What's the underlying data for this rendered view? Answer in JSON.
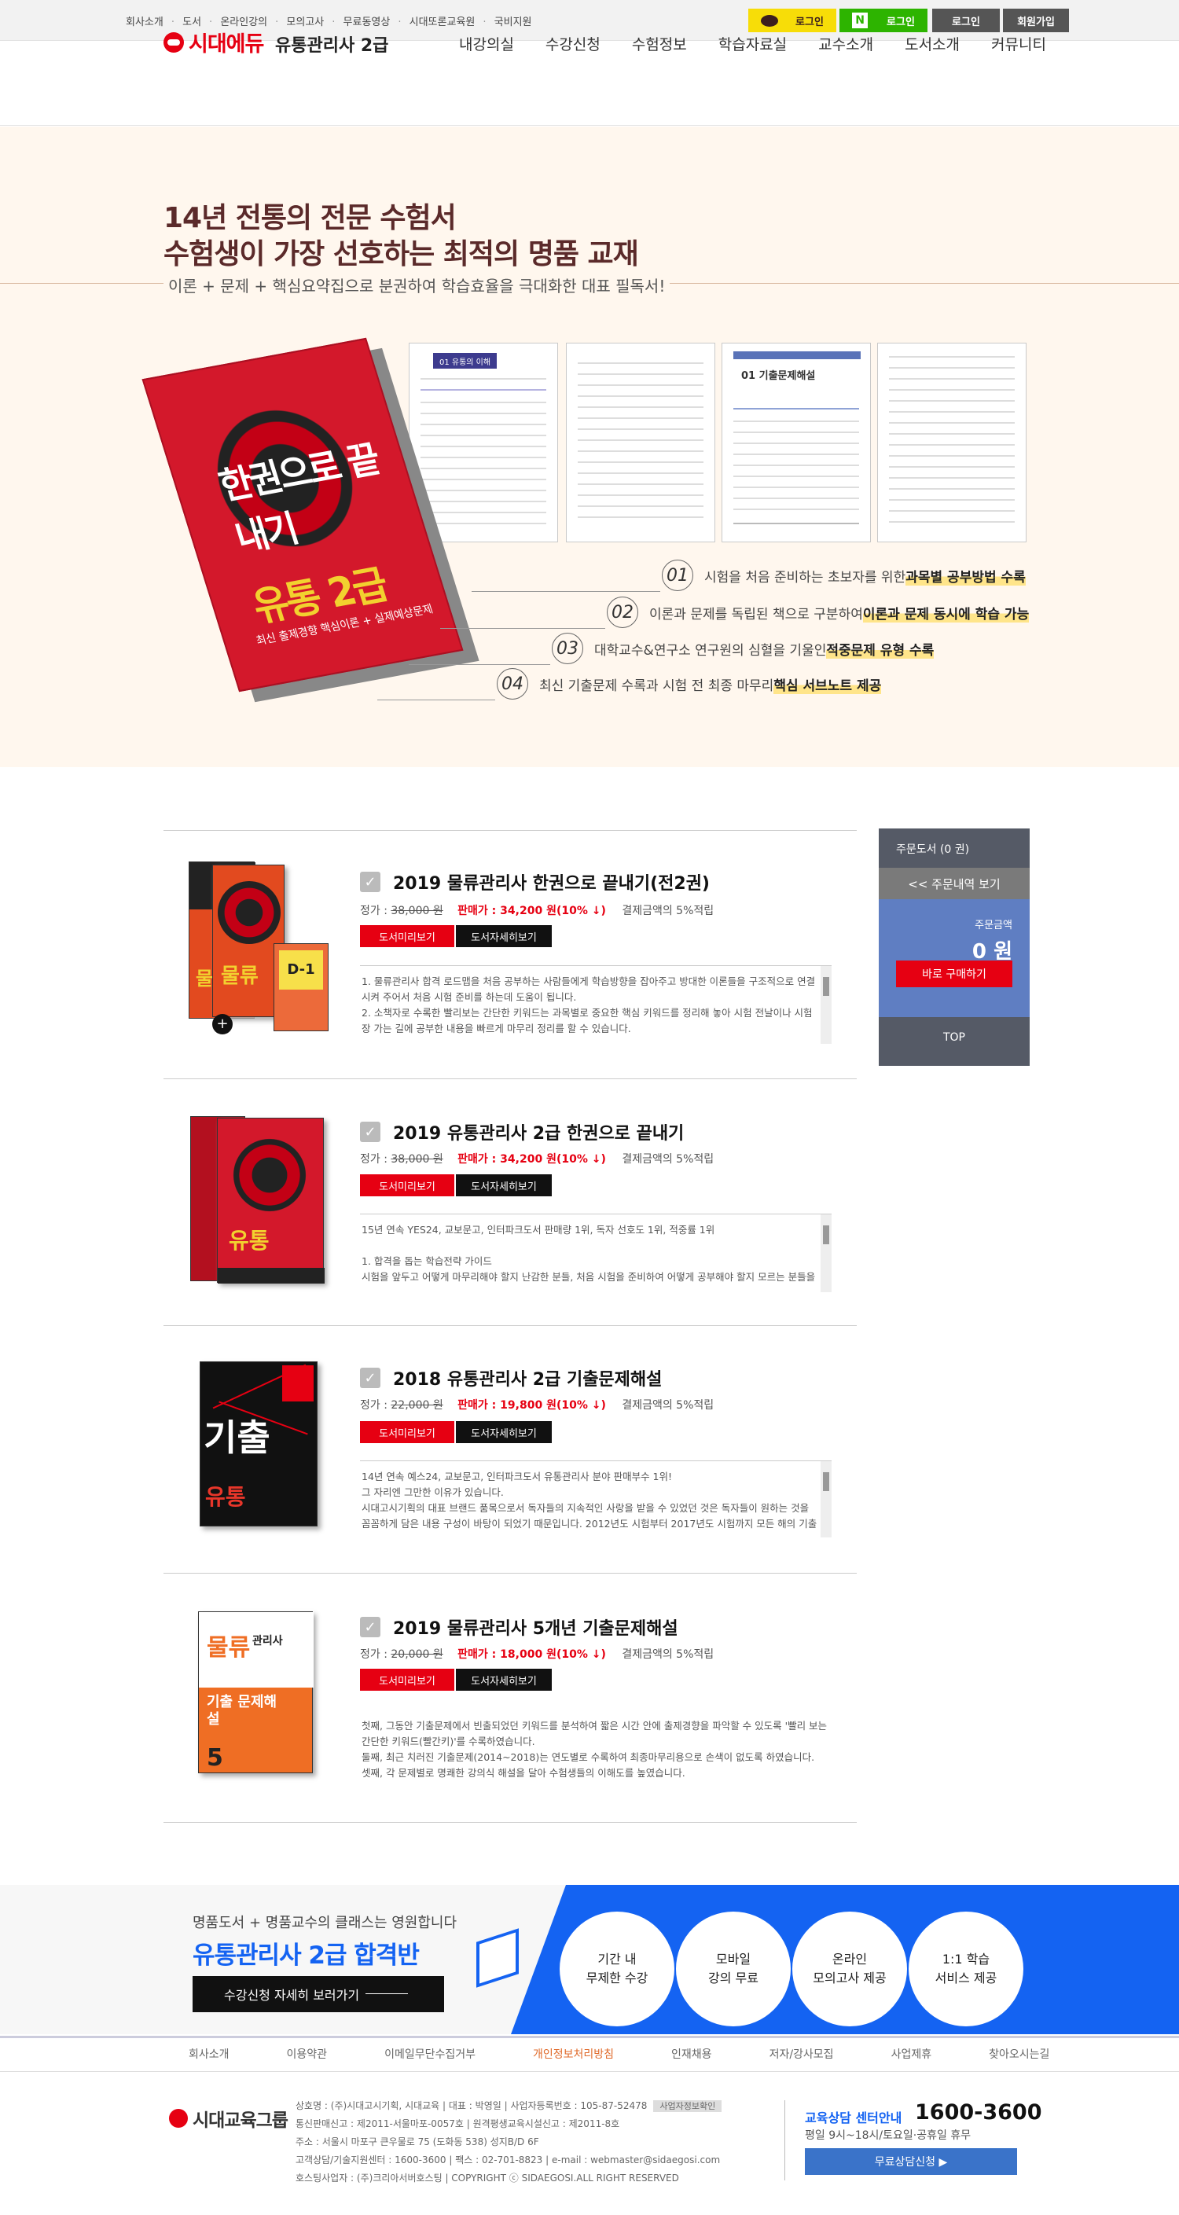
{
  "topbar": {
    "links": [
      "회사소개",
      "도서",
      "온라인강의",
      "모의고사",
      "무료동영상",
      "시대또론교육원",
      "국비지원"
    ],
    "kakao_login": "로그인",
    "naver_login": "로그인",
    "login": "로그인",
    "join": "회원가입"
  },
  "header": {
    "logo": "시대에듀",
    "site_name": "유통관리사 2급",
    "nav": [
      "내강의실",
      "수강신청",
      "수험정보",
      "학습자료실",
      "교수소개",
      "도서소개",
      "커뮤니티"
    ]
  },
  "hero": {
    "title_line1": "14년 전통의 전문 수험서",
    "title_line2": "수험생이 가장 선호하는 최적의 명품 교재",
    "subtitle": "이론 + 문제 + 핵심요약집으로 분권하여 학습효율을 극대화한 대표 필독서!",
    "book_title": "한권으로 끝내기",
    "book_subject": "유통 2급",
    "book_tagline": "최신 출제경향 핵심이론 + 실제예상문제",
    "page_headings": [
      "01 유통의 이해",
      "01 기출문제해설"
    ],
    "features": [
      {
        "num": "01",
        "text": "시험을 처음 준비하는 초보자를 위한 ",
        "highlight": "과목별 공부방법 수록"
      },
      {
        "num": "02",
        "text": "이론과 문제를 독립된 책으로 구분하여 ",
        "highlight": "이론과 문제 동시에 학습 가능"
      },
      {
        "num": "03",
        "text": "대학교수&연구소 연구원의 심혈을 기울인 ",
        "highlight": "적중문제 유형 수록"
      },
      {
        "num": "04",
        "text": "최신 기출문제 수록과 시험 전 최종 마무리 ",
        "highlight": "핵심 서브노트 제공"
      }
    ]
  },
  "products": [
    {
      "title": "2019 물류관리사 한권으로 끝내기(전2권)",
      "price_label": "정가 :",
      "orig_price": "38,000 원",
      "sale_label": "판매가 :",
      "sale_price": "34,200 원(10% ↓)",
      "point": "결제금액의 5%적립",
      "preview_btn": "도서미리보기",
      "detail_btn": "도서자세히보기",
      "desc": [
        "1. 물류관리사 합격 로드맵을 처음 공부하는 사람들에게 학습방향을 잡아주고 방대한 이론들을 구조적으로 연결시켜 주어서 처음 시험 준비를 하는데 도움이 됩니다.",
        "2. 소책자로 수록한 빨리보는 간단한 키워드는 과목별로 중요한 핵심 키워드를 정리해 놓아 시험 전날이나 시험장 가는 길에 공부한 내용을 빠르게 마무리 정리를 할 수 있습니다."
      ],
      "cover_main": "물류",
      "cover_side": "D-1"
    },
    {
      "title": "2019 유통관리사 2급 한권으로 끝내기",
      "price_label": "정가 :",
      "orig_price": "38,000 원",
      "sale_label": "판매가 :",
      "sale_price": "34,200 원(10% ↓)",
      "point": "결제금액의 5%적립",
      "preview_btn": "도서미리보기",
      "detail_btn": "도서자세히보기",
      "desc": [
        "15년 연속 YES24, 교보문고, 인터파크도서 판매량 1위, 독자 선호도 1위, 적중률 1위",
        "",
        "1. 합격을 돕는 학습전략 가이드",
        "시험을 앞두고 어떻게 마무리해야 할지 난감한 분들, 처음 시험을 준비하여 어떻게 공부해야 할지 모르는 분들을"
      ],
      "cover_main": "유통"
    },
    {
      "title": "2018 유통관리사 2급 기출문제해설",
      "price_label": "정가 :",
      "orig_price": "22,000 원",
      "sale_label": "판매가 :",
      "sale_price": "19,800 원(10% ↓)",
      "point": "결제금액의 5%적립",
      "preview_btn": "도서미리보기",
      "detail_btn": "도서자세히보기",
      "desc": [
        "14년 연속 예스24, 교보문고, 인터파크도서 유통관리사 분야 판매부수 1위!",
        "그 자리엔 그만한 이유가 있습니다.",
        "시대고시기획의 대표 브랜드 품목으로서 독자들의 지속적인 사랑을 받을 수 있었던 것은 독자들이 원하는 것을",
        "꼼꼼하게 담은 내용 구성이 바탕이 되었기 때문입니다. 2012년도 시험부터 2017년도 시험까지 모든 해의 기출"
      ],
      "cover_main": "기출",
      "cover_sub": "유통"
    },
    {
      "title": "2019 물류관리사 5개년 기출문제해설",
      "price_label": "정가 :",
      "orig_price": "20,000 원",
      "sale_label": "판매가 :",
      "sale_price": "18,000 원(10% ↓)",
      "point": "결제금액의 5%적립",
      "preview_btn": "도서미리보기",
      "detail_btn": "도서자세히보기",
      "desc": [
        "첫째, 그동안 기출문제에서 빈출되었던 키워드를 분석하여 짧은 시간 안에 출제경향을 파악할 수 있도록 '빨리 보는",
        "간단한 키워드(빨간키)'를 수록하였습니다.",
        "둘째, 최근 치러진 기출문제(2014~2018)는 연도별로 수록하여 최종마무리용으로 손색이 없도록 하였습니다.",
        "셋째, 각 문제별로 명쾌한 강의식 해설을 달아 수험생들의 이해도를 높였습니다."
      ],
      "cover_main": "물류",
      "cover_sub": "관리사",
      "cover_tag": "기출 문제해설"
    }
  ],
  "cart": {
    "title": "주문도서 (0 권)",
    "view_btn": "<< 주문내역 보기",
    "amount_label": "주문금액",
    "amount_value": "0 원",
    "buy_btn": "바로 구매하기",
    "top": "TOP"
  },
  "banner": {
    "line1": "명품도서 + 명품교수의 클래스는 영원합니다",
    "line2": "유통관리사 2급 합격반",
    "button": "수강신청 자세히 보러가기",
    "circles": [
      [
        "기간 내",
        "무제한 수강"
      ],
      [
        "모바일",
        "강의 무료"
      ],
      [
        "온라인",
        "모의고사 제공"
      ],
      [
        "1:1 학습",
        "서비스 제공"
      ]
    ],
    "plus": "+"
  },
  "footer": {
    "nav": [
      "회사소개",
      "이용약관",
      "이메일무단수집거부",
      "개인정보처리방침",
      "인재채용",
      "저자/강사모집",
      "사업제휴",
      "찾아오시는길"
    ],
    "logo": "시대교육그룹",
    "info": [
      "상호명 : (주)시대고시기획, 시대교육 | 대표 : 박영일 | 사업자등록번호 : 105-87-52478",
      "통신판매신고 : 제2011-서울마포-0057호 | 원격평생교육시설신고 : 제2011-8호",
      "주소 : 서울시 마포구 큰우물로 75 (도화동 538) 성지B/D 6F",
      "고객상담/기술지원센터 : 1600-3600 | 팩스 : 02-701-8823 | e-mail : webmaster@sidaegosi.com",
      "호스팅사업자 : (주)크리아서버호스팅 | COPYRIGHT ⓒ SIDAEGOSI.ALL RIGHT RESERVED"
    ],
    "biz_check": "사업자정보확인",
    "cs_label": "교육상담 센터안내",
    "cs_number": "1600-3600",
    "cs_hours": "평일 9시~18시/토요일·공휴일 휴무",
    "cs_btn": "무료상담신청 ▶"
  }
}
